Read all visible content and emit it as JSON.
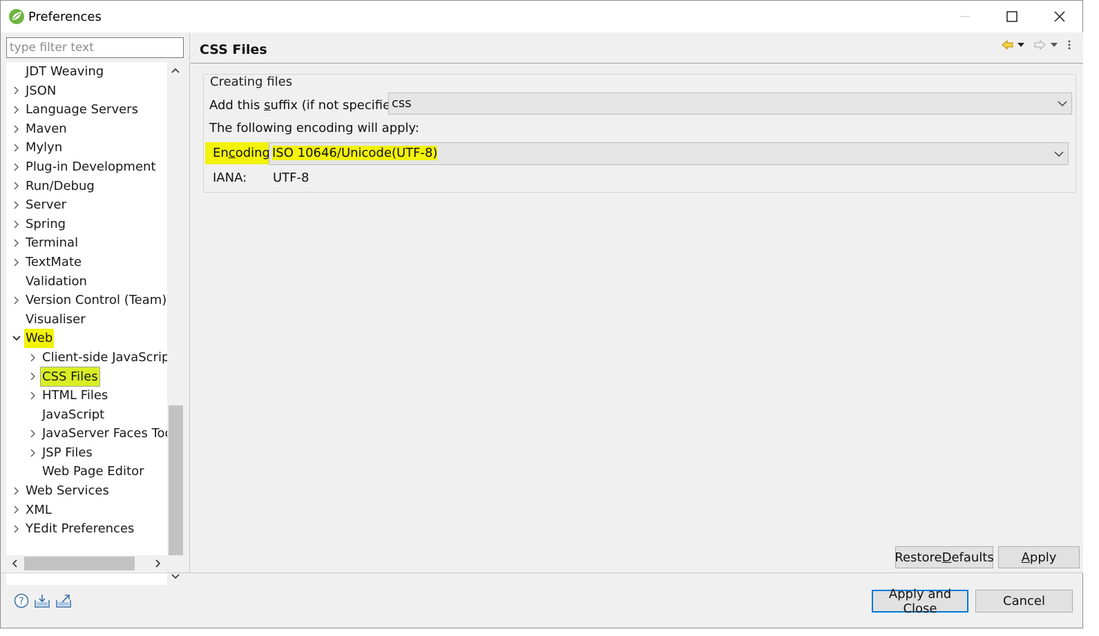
{
  "window": {
    "title": "Preferences",
    "icon": "spring-leaf-icon"
  },
  "filter": {
    "placeholder": "type filter text",
    "value": ""
  },
  "tree": {
    "items": [
      {
        "label": "JDT Weaving",
        "level": 0,
        "expandable": false
      },
      {
        "label": "JSON",
        "level": 0,
        "expandable": true
      },
      {
        "label": "Language Servers",
        "level": 0,
        "expandable": true
      },
      {
        "label": "Maven",
        "level": 0,
        "expandable": true
      },
      {
        "label": "Mylyn",
        "level": 0,
        "expandable": true
      },
      {
        "label": "Plug-in Development",
        "level": 0,
        "expandable": true
      },
      {
        "label": "Run/Debug",
        "level": 0,
        "expandable": true
      },
      {
        "label": "Server",
        "level": 0,
        "expandable": true
      },
      {
        "label": "Spring",
        "level": 0,
        "expandable": true
      },
      {
        "label": "Terminal",
        "level": 0,
        "expandable": true
      },
      {
        "label": "TextMate",
        "level": 0,
        "expandable": true
      },
      {
        "label": "Validation",
        "level": 0,
        "expandable": false
      },
      {
        "label": "Version Control (Team)",
        "level": 0,
        "expandable": true
      },
      {
        "label": "Visualiser",
        "level": 0,
        "expandable": false
      },
      {
        "label": "Web",
        "level": 0,
        "expandable": true,
        "expanded": true,
        "highlighted": true
      },
      {
        "label": "Client-side JavaScript",
        "level": 1,
        "expandable": true
      },
      {
        "label": "CSS Files",
        "level": 1,
        "expandable": true,
        "selected": true
      },
      {
        "label": "HTML Files",
        "level": 1,
        "expandable": true
      },
      {
        "label": "JavaScript",
        "level": 1,
        "expandable": false
      },
      {
        "label": "JavaServer Faces Tools",
        "level": 1,
        "expandable": true
      },
      {
        "label": "JSP Files",
        "level": 1,
        "expandable": true
      },
      {
        "label": "Web Page Editor",
        "level": 1,
        "expandable": false
      },
      {
        "label": "Web Services",
        "level": 0,
        "expandable": true
      },
      {
        "label": "XML",
        "level": 0,
        "expandable": true
      },
      {
        "label": "YEdit Preferences",
        "level": 0,
        "expandable": true
      }
    ]
  },
  "page": {
    "title": "CSS Files",
    "group_title": "Creating files",
    "suffix_label_pre": "Add this ",
    "suffix_label_mnemonic": "s",
    "suffix_label_post": "uffix (if not specified):",
    "suffix_value": "css",
    "encoding_note": "The following encoding will apply:",
    "encoding_label_pre": "En",
    "encoding_label_mnemonic": "c",
    "encoding_label_post": "oding:",
    "encoding_value": "ISO 10646/Unicode(UTF-8)",
    "iana_label": "IANA:",
    "iana_value": "UTF-8"
  },
  "buttons": {
    "restore_pre": "Restore ",
    "restore_mnemonic": "D",
    "restore_post": "efaults",
    "apply_mnemonic": "A",
    "apply_post": "pply",
    "apply_close": "Apply and Close",
    "cancel": "Cancel"
  },
  "colors": {
    "highlight": "#f2f20a",
    "selection": "#d9ef24",
    "default_button_border": "#0078d7",
    "back_arrow": "#e8b400"
  },
  "icons": {
    "nav": [
      "back-arrow-icon",
      "back-menu-icon",
      "forward-arrow-icon",
      "forward-menu-icon",
      "view-menu-icon"
    ],
    "bottom": [
      "help-icon",
      "import-icon",
      "export-icon"
    ]
  }
}
